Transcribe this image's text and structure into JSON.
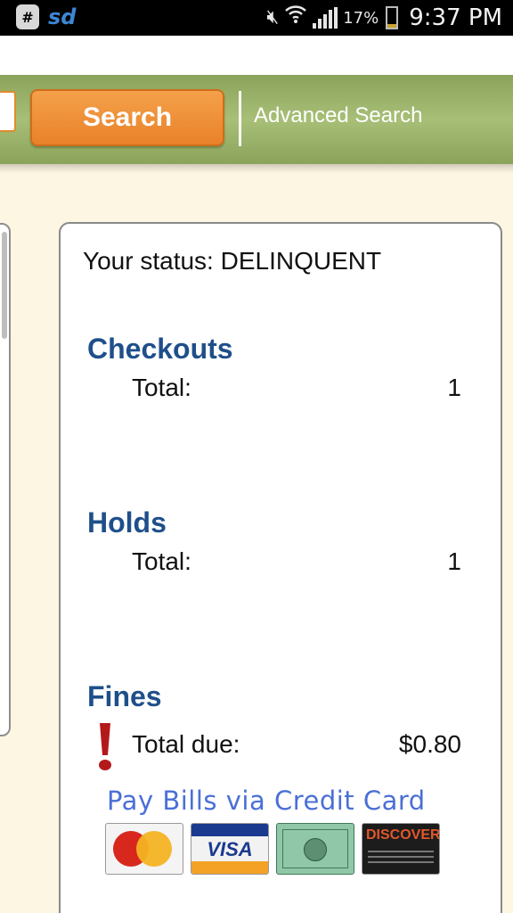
{
  "status_bar": {
    "battery_pct": "17%",
    "time": "9:37 PM",
    "icons": [
      "app-notification-icon",
      "sd-app-icon",
      "mute-icon",
      "wifi-icon",
      "signal-icon",
      "battery-icon"
    ]
  },
  "search": {
    "button_label": "Search",
    "advanced_label": "Advanced Search"
  },
  "account": {
    "status_line": "Your status: DELINQUENT",
    "checkouts": {
      "title": "Checkouts",
      "label": "Total:",
      "value": "1"
    },
    "holds": {
      "title": "Holds",
      "label": "Total:",
      "value": "1"
    },
    "fines": {
      "title": "Fines",
      "label": "Total due:",
      "value": "$0.80"
    },
    "pay_link": "Pay Bills via Credit Card"
  },
  "colors": {
    "accent_orange": "#e9822a",
    "header_green": "#8aa25a",
    "section_blue": "#1f4f8a",
    "alert_red": "#b3191b"
  }
}
